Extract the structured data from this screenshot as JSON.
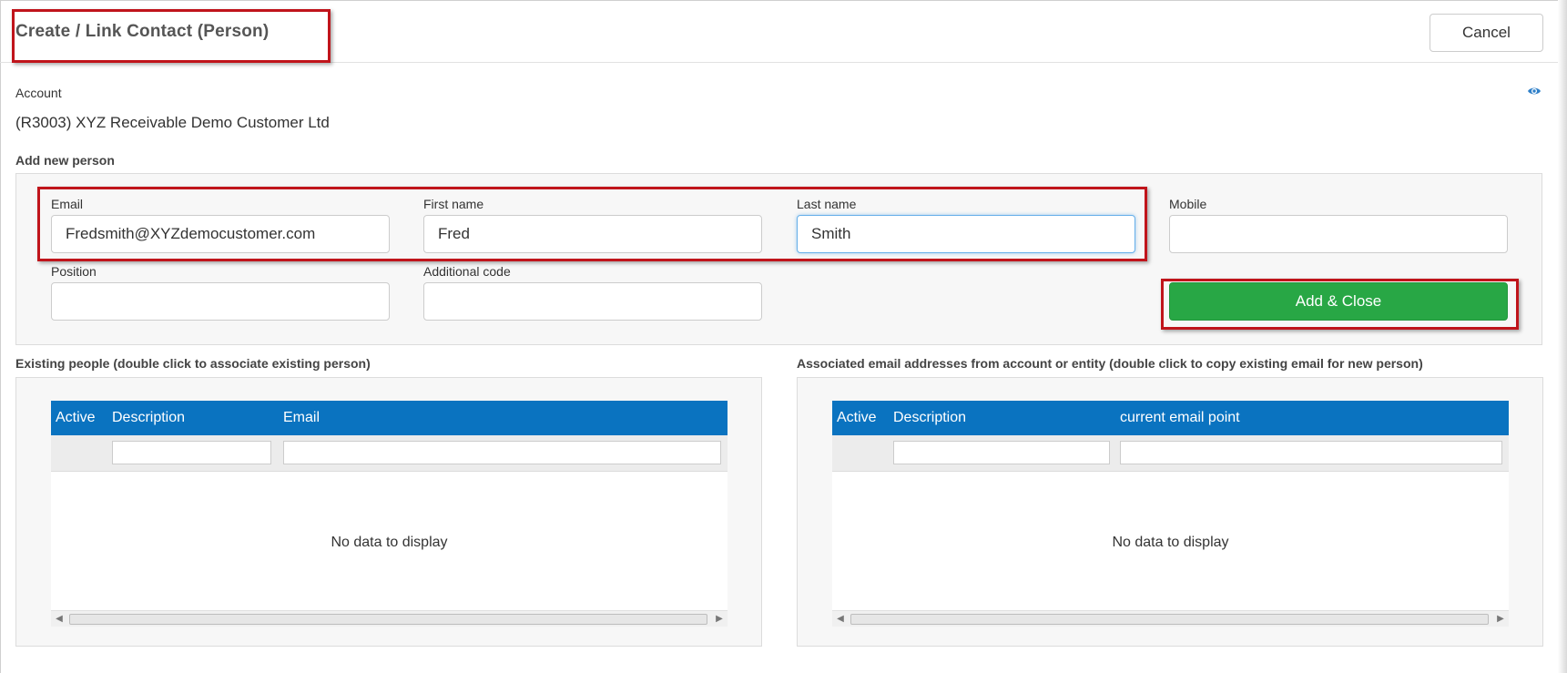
{
  "dialog": {
    "title": "Create / Link Contact (Person)",
    "cancel_label": "Cancel"
  },
  "account": {
    "label": "Account",
    "value": "(R3003) XYZ Receivable Demo Customer Ltd",
    "view_icon": "eye-icon"
  },
  "add_person": {
    "section_title": "Add new person",
    "fields": {
      "email": {
        "label": "Email",
        "value": "Fredsmith@XYZdemocustomer.com"
      },
      "first_name": {
        "label": "First name",
        "value": "Fred"
      },
      "last_name": {
        "label": "Last name",
        "value": "Smith"
      },
      "mobile": {
        "label": "Mobile",
        "value": ""
      },
      "position": {
        "label": "Position",
        "value": ""
      },
      "additional_code": {
        "label": "Additional code",
        "value": ""
      }
    },
    "add_close_label": "Add & Close"
  },
  "existing_people": {
    "section_title": "Existing people (double click to associate existing person)",
    "columns": [
      "Active",
      "Description",
      "Email"
    ],
    "rows": [],
    "empty_text": "No data to display"
  },
  "associated_emails": {
    "section_title": "Associated email addresses from account or entity (double click to copy existing email for new person)",
    "columns": [
      "Active",
      "Description",
      "current email point"
    ],
    "rows": [],
    "empty_text": "No data to display"
  },
  "colors": {
    "grid_header": "#0a73c0",
    "add_button": "#28a745",
    "highlight": "#c0141b",
    "eye_icon": "#2f80c9"
  }
}
